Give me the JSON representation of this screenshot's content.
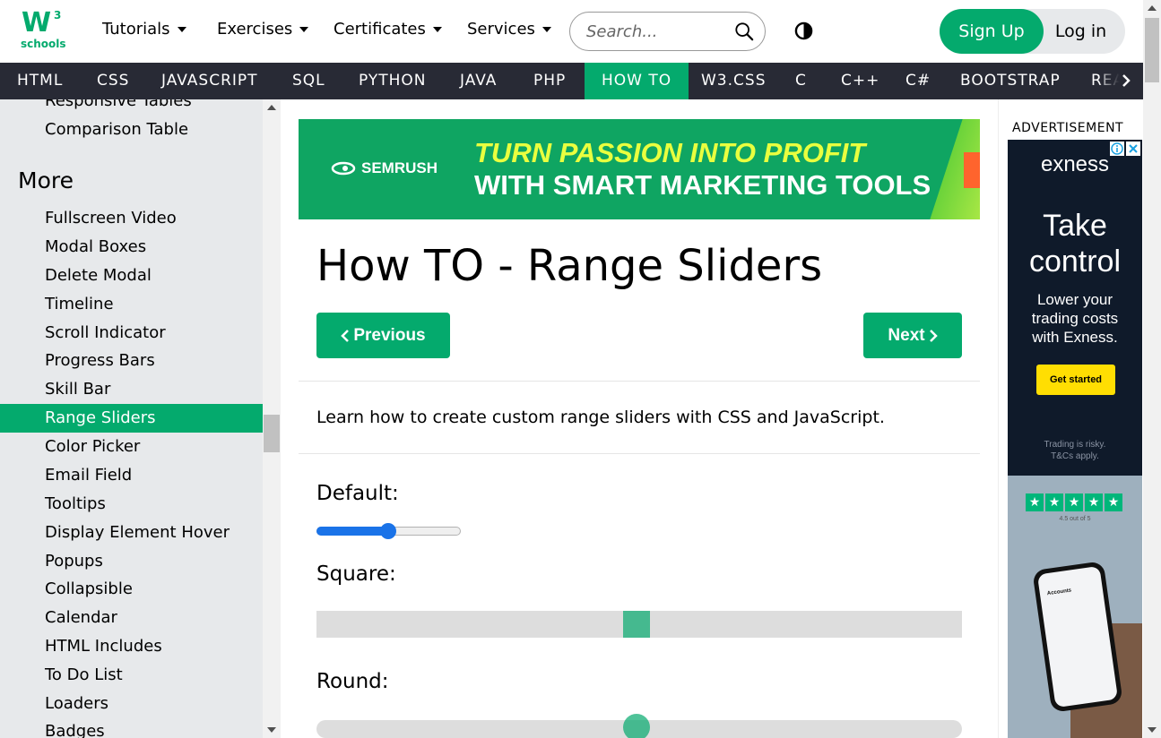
{
  "logo": {
    "mark": "W",
    "superscript": "3",
    "text": "schools"
  },
  "topnav": {
    "items": [
      "Tutorials",
      "Exercises",
      "Certificates",
      "Services"
    ],
    "search_placeholder": "Search...",
    "signup_label": "Sign Up",
    "login_label": "Log in"
  },
  "subnav": {
    "items": [
      "HTML",
      "CSS",
      "JAVASCRIPT",
      "SQL",
      "PYTHON",
      "JAVA",
      "PHP",
      "HOW TO",
      "W3.CSS",
      "C",
      "C++",
      "C#",
      "BOOTSTRAP",
      "REACT"
    ],
    "active": "HOW TO"
  },
  "sidebar": {
    "top_items": [
      "Responsive Tables",
      "Comparison Table"
    ],
    "section_heading": "More",
    "items": [
      "Fullscreen Video",
      "Modal Boxes",
      "Delete Modal",
      "Timeline",
      "Scroll Indicator",
      "Progress Bars",
      "Skill Bar",
      "Range Sliders",
      "Color Picker",
      "Email Field",
      "Tooltips",
      "Display Element Hover",
      "Popups",
      "Collapsible",
      "Calendar",
      "HTML Includes",
      "To Do List",
      "Loaders",
      "Badges"
    ],
    "active": "Range Sliders"
  },
  "banner": {
    "brand": "SEMRUSH",
    "line1": "TURN PASSION INTO PROFIT",
    "line2": "WITH SMART MARKETING TOOLS"
  },
  "main": {
    "title": "How TO - Range Sliders",
    "previous_label": "Previous",
    "next_label": "Next",
    "intro": "Learn how to create custom range sliders with CSS and JavaScript.",
    "default_label": "Default:",
    "square_label": "Square:",
    "round_label": "Round:"
  },
  "sliders": {
    "default_value": 50,
    "square_value": 50,
    "round_value": 50,
    "min": 1,
    "max": 100
  },
  "ad": {
    "label": "ADVERTISEMENT",
    "brand": "exness",
    "headline_1": "Take",
    "headline_2": "control",
    "sub_1": "Lower your",
    "sub_2": "trading costs",
    "sub_3": "with Exness.",
    "cta": "Get started",
    "risk_1": "Trading is risky.",
    "risk_2": "T&Cs apply.",
    "rating": "4.5 out of 5",
    "phone_text": "Accounts"
  },
  "colors": {
    "brand_green": "#04AA6D",
    "nav_dark": "#282A35",
    "sidebar_bg": "#E7E9EB",
    "slider_blue": "#1A73E8"
  },
  "icons": {
    "search": "search-icon",
    "contrast": "contrast-icon",
    "prev": "chevron-left-icon",
    "next": "chevron-right-icon",
    "subnav_more": "chevron-right-icon"
  }
}
